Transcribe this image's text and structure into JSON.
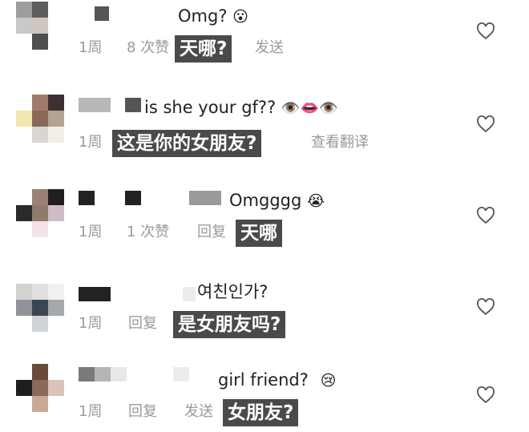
{
  "comments": [
    {
      "text": "Omg?",
      "emoji": "😮",
      "time": "1周",
      "likes": "8 次赞",
      "subtitle": "天哪?",
      "action": "发送"
    },
    {
      "text": "is she your gf??",
      "emoji": "👁️👄👁️",
      "time": "1周",
      "subtitle": "这是你的女朋友?",
      "action": "查看翻译"
    },
    {
      "text": "Omgggg",
      "emoji": "😭",
      "time": "1周",
      "likes": "1 次赞",
      "reply": "回复",
      "subtitle": "天哪"
    },
    {
      "text": "여친인가?",
      "time": "1周",
      "reply": "回复",
      "subtitle": "是女朋友吗?"
    },
    {
      "text": "girl friend?",
      "emoji": "😢",
      "time": "1周",
      "reply": "回复",
      "action": "发送",
      "subtitle": "女朋友?"
    }
  ],
  "colors": {
    "subtitle_bg": "#4a4a4a",
    "meta_text": "#9a9a9a",
    "heart_stroke": "#555555"
  },
  "icons": {
    "like": "heart-outline-icon"
  }
}
